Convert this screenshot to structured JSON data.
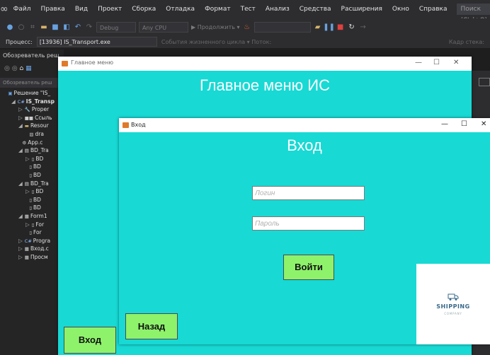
{
  "vs": {
    "menu_items": [
      "Файл",
      "Правка",
      "Вид",
      "Проект",
      "Сборка",
      "Отладка",
      "Формат",
      "Тест",
      "Анализ",
      "Средства",
      "Расширения",
      "Окно",
      "Справка"
    ],
    "search_placeholder": "Поиск (Ctrl+Q)",
    "toolbar": {
      "config": "Debug",
      "platform": "Any CPU",
      "continue": "▶ Продолжить ▾",
      "lifecycle": "События жизненного цикла ▾ Поток:",
      "stack_frame": "Кадр стека:"
    },
    "process_label": "Процесс:",
    "process_value": "[13936] IS_Transport.exe",
    "se_title": "Обозреватель реш",
    "se_search": "Обозреватель реш",
    "tree": [
      {
        "label": "Решение \"IS_",
        "indent": 0,
        "twisty": "",
        "icon": "solution-icon"
      },
      {
        "label": "IS_Transp",
        "indent": 1,
        "twisty": "◢",
        "icon": "csharp-project-icon",
        "bold": true
      },
      {
        "label": "Proper",
        "indent": 2,
        "twisty": "▷",
        "icon": "wrench-icon"
      },
      {
        "label": "Ссыль",
        "indent": 2,
        "twisty": "▷",
        "icon": "references-icon"
      },
      {
        "label": "Resour",
        "indent": 2,
        "twisty": "◢",
        "icon": "folder-icon"
      },
      {
        "label": "dra",
        "indent": 3,
        "twisty": "",
        "icon": "image-icon"
      },
      {
        "label": "App.c",
        "indent": 2,
        "twisty": "",
        "icon": "config-icon"
      },
      {
        "label": "BD_Tra",
        "indent": 2,
        "twisty": "◢",
        "icon": "database-icon"
      },
      {
        "label": "BD",
        "indent": 3,
        "twisty": "▷",
        "icon": "file-icon"
      },
      {
        "label": "BD",
        "indent": 3,
        "twisty": "",
        "icon": "file-icon"
      },
      {
        "label": "BD",
        "indent": 3,
        "twisty": "",
        "icon": "file-icon"
      },
      {
        "label": "BD_Tra",
        "indent": 2,
        "twisty": "◢",
        "icon": "database-icon"
      },
      {
        "label": "BD",
        "indent": 3,
        "twisty": "▷",
        "icon": "file-icon"
      },
      {
        "label": "BD",
        "indent": 3,
        "twisty": "",
        "icon": "file-icon"
      },
      {
        "label": "BD",
        "indent": 3,
        "twisty": "",
        "icon": "file-icon"
      },
      {
        "label": "Form1",
        "indent": 2,
        "twisty": "◢",
        "icon": "form-icon"
      },
      {
        "label": "For",
        "indent": 3,
        "twisty": "▷",
        "icon": "file-icon"
      },
      {
        "label": "For",
        "indent": 3,
        "twisty": "",
        "icon": "file-icon"
      },
      {
        "label": "Progra",
        "indent": 2,
        "twisty": "▷",
        "icon": "csharp-file-icon"
      },
      {
        "label": "Вход.c",
        "indent": 2,
        "twisty": "▷",
        "icon": "form-icon"
      },
      {
        "label": "Просм",
        "indent": 2,
        "twisty": "▷",
        "icon": "form-icon"
      }
    ]
  },
  "main_menu": {
    "window_title": "Главное меню",
    "heading": "Главное меню ИС",
    "enter_button": "Вход",
    "controls": {
      "min": "—",
      "max": "☐",
      "close": "✕"
    }
  },
  "login": {
    "window_title": "Вход",
    "heading": "Вход",
    "login_placeholder": "Логин",
    "password_placeholder": "Пароль",
    "login_button": "Войти",
    "back_button": "Назад",
    "logo_text": "SHIPPING",
    "logo_sub": "COMPANY",
    "controls": {
      "min": "—",
      "max": "☐",
      "close": "✕"
    }
  },
  "colors": {
    "form_bg": "#18d9d4",
    "button_bg": "#8ef26b",
    "vs_dark": "#2d2d30",
    "window_icon": "#e07a2b"
  }
}
